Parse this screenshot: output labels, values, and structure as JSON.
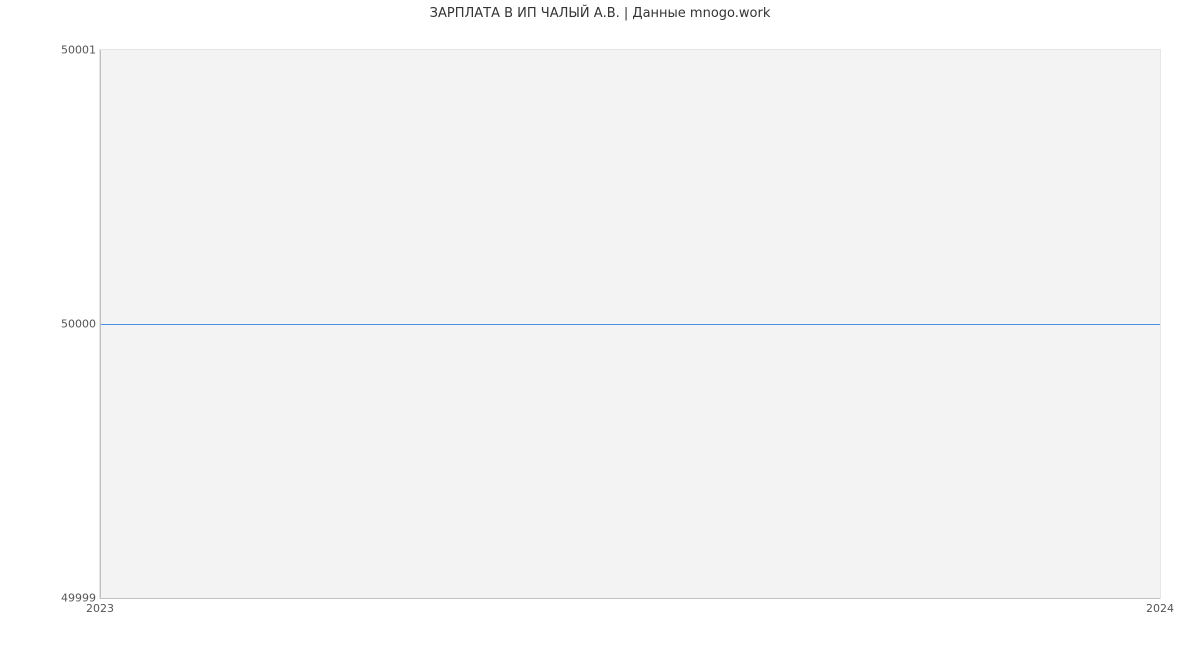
{
  "chart_data": {
    "type": "line",
    "title": "ЗАРПЛАТА В ИП ЧАЛЫЙ А.В. | Данные mnogo.work",
    "xlabel": "",
    "ylabel": "",
    "x": [
      2023,
      2024
    ],
    "values": [
      50000,
      50000
    ],
    "xlim": [
      2023,
      2024
    ],
    "ylim": [
      49999,
      50001
    ],
    "x_ticks": [
      "2023",
      "2024"
    ],
    "y_ticks": [
      "49999",
      "50000",
      "50001"
    ],
    "line_color": "#4a90e2",
    "background": "#f3f3f3"
  }
}
